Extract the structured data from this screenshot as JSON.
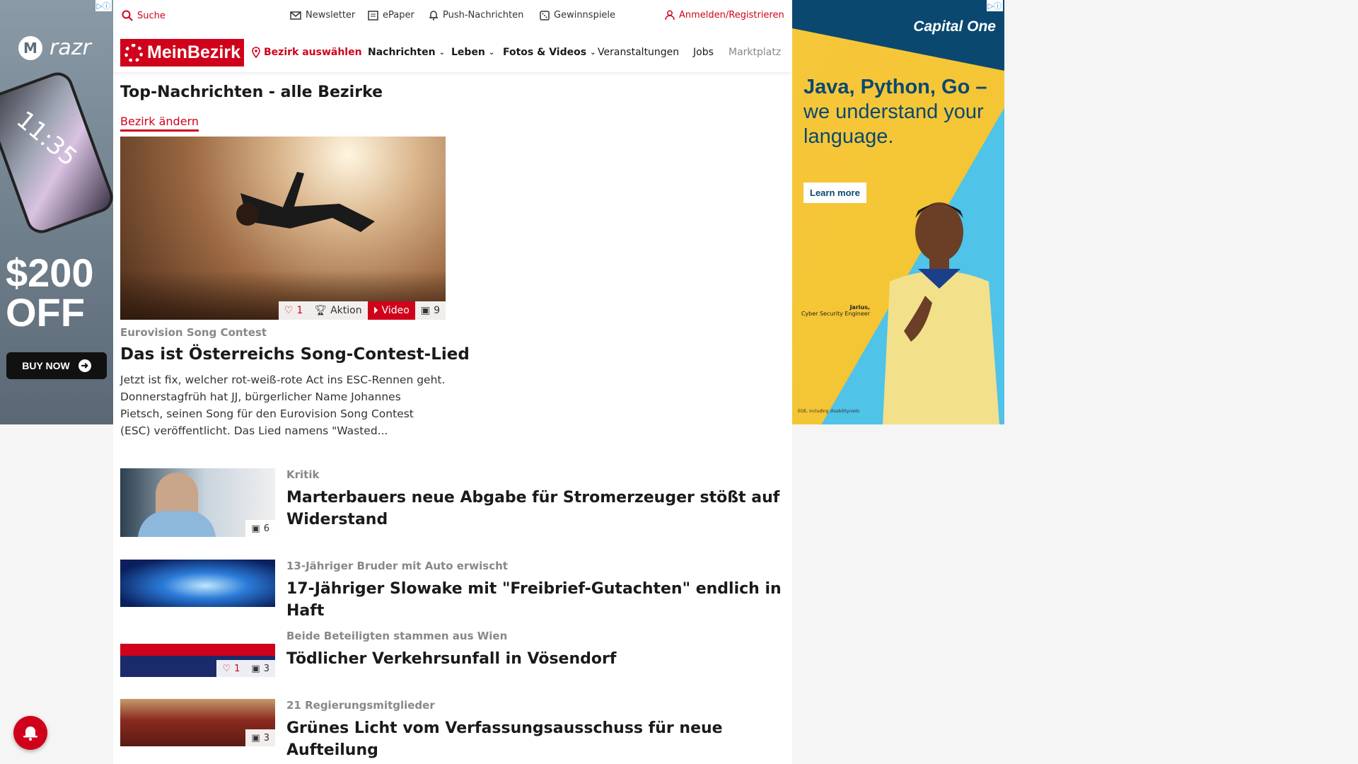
{
  "topbar": {
    "search": "Suche",
    "newsletter": "Newsletter",
    "epaper": "ePaper",
    "push": "Push-Nachrichten",
    "gewinnspiele": "Gewinnspiele",
    "login": "Anmelden/Registrieren"
  },
  "nav": {
    "logo": "MeinBezirk",
    "bezirk": "Bezirk auswählen",
    "items": [
      "Nachrichten",
      "Leben",
      "Fotos & Videos",
      "Veranstaltungen",
      "Jobs",
      "Marktplatz"
    ]
  },
  "page": {
    "title": "Top-Nachrichten - alle Bezirke",
    "bezirk_link": "Bezirk ändern"
  },
  "hero": {
    "likes": "1",
    "aktion": "Aktion",
    "video": "Video",
    "images": "9",
    "category": "Eurovision Song Contest",
    "title": "Das ist Österreichs Song-Contest-Lied",
    "text": "Jetzt ist fix, welcher rot-weiß-rote Act ins ESC-Rennen geht. Donnerstagfrüh hat JJ, bürgerlicher Name Johannes Pietsch, seinen Song für den Eurovision Song Contest (ESC) veröffentlicht. Das Lied namens \"Wasted..."
  },
  "articles": [
    {
      "category": "Kritik",
      "title": "Marterbauers neue Abgabe für Stromerzeuger stößt auf Widerstand",
      "images": "6"
    },
    {
      "category": "13-Jähriger Bruder mit Auto erwischt",
      "title": "17-Jähriger Slowake mit \"Freibrief-Gutachten\" endlich in Haft"
    },
    {
      "category": "Beide Beteiligten stammen aus Wien",
      "title": "Tödlicher Verkehrsunfall in Vösendorf",
      "likes": "1",
      "images": "3"
    },
    {
      "category": "21 Regierungsmitglieder",
      "title": "Grünes Licht vom Verfassungsausschuss für neue Aufteilung",
      "images": "3"
    }
  ],
  "ad_left": {
    "brand": "razr",
    "time": "11:35",
    "promo_1": "$200",
    "promo_2": "OFF",
    "cta": "BUY NOW"
  },
  "ad_right": {
    "brand": "Capital One",
    "headline_1": "Java, Python, Go –",
    "headline_2": "we understand your language.",
    "cta": "Learn more",
    "caption_name": "Jarius,",
    "caption_role": "Cyber Security Engineer",
    "fine_print": "EOE, including disability/vets"
  },
  "colors": {
    "brand_red": "#d0021b",
    "capone_navy": "#0a4870",
    "capone_yellow": "#f4c534"
  }
}
